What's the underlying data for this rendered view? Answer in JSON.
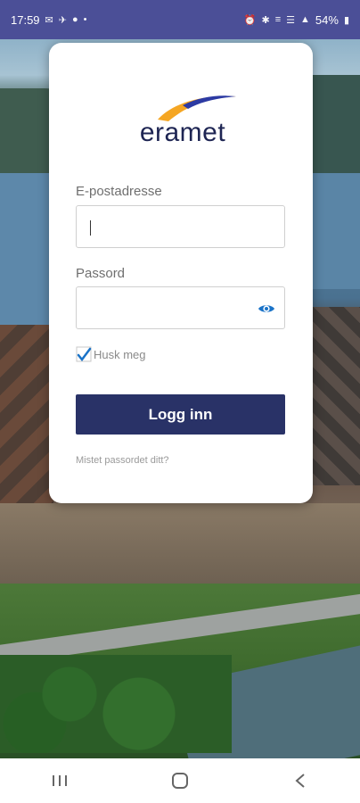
{
  "status_bar": {
    "time": "17:59",
    "left_icons": [
      "message-icon",
      "airplane-icon",
      "facebook-icon",
      "dot-icon"
    ],
    "right_icons": [
      "alarm-icon",
      "bluetooth-icon",
      "volte-icon",
      "wifi-icon",
      "signal-icon"
    ],
    "battery": "54%"
  },
  "login": {
    "logo_text": "eramet",
    "email_label": "E-postadresse",
    "email_value": "",
    "password_label": "Passord",
    "password_value": "",
    "remember_label": "Husk meg",
    "remember_checked": true,
    "login_button": "Logg inn",
    "forgot_link": "Mistet passordet ditt?"
  },
  "nav_bar": {
    "items": [
      "recent-apps-icon",
      "home-icon",
      "back-icon"
    ]
  },
  "colors": {
    "status_bar": "#4b4f97",
    "primary_button": "#293267",
    "logo_text": "#1e2553",
    "logo_swoosh_blue": "#2c3aa3",
    "logo_swoosh_orange": "#f5a623",
    "checkbox_tick": "#1a73c8"
  }
}
